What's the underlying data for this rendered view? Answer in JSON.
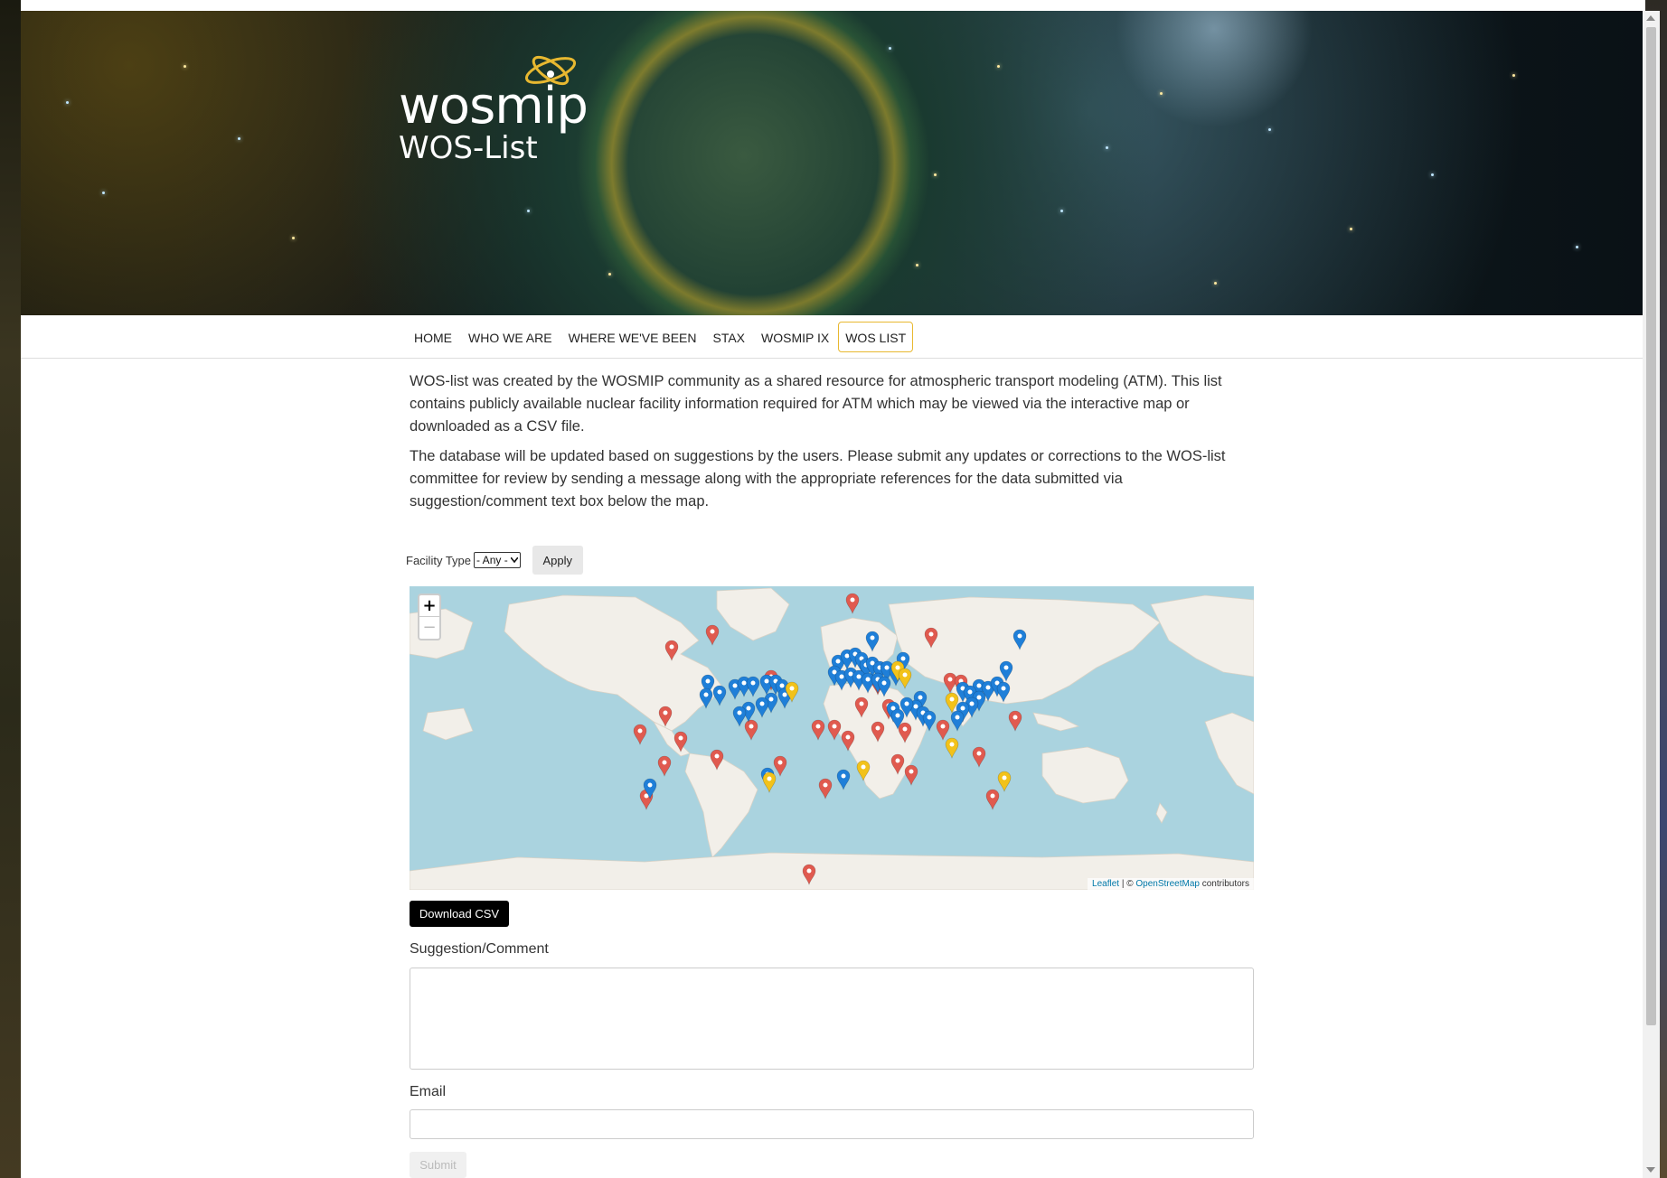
{
  "header": {
    "logo_text": "wosmip",
    "subtitle": "WOS-List"
  },
  "nav": {
    "items": [
      {
        "label": "HOME",
        "active": false
      },
      {
        "label": "WHO WE ARE",
        "active": false
      },
      {
        "label": "WHERE WE'VE BEEN",
        "active": false
      },
      {
        "label": "STAX",
        "active": false
      },
      {
        "label": "WOSMIP IX",
        "active": false
      },
      {
        "label": "WOS LIST",
        "active": true
      }
    ]
  },
  "intro": {
    "paragraph1": "WOS-list was created by the WOSMIP community as a shared resource for atmospheric transport modeling (ATM). This list contains publicly available nuclear facility information required for ATM which may be viewed via the interactive map or downloaded as a CSV file.",
    "paragraph2": "The database will be updated based on suggestions by the users. Please submit any updates or corrections to the WOS-list committee for review by sending a message along with the appropriate references for the data submitted via suggestion/comment text box below the map."
  },
  "filter": {
    "label": "Facility Type",
    "selected": "- Any -",
    "apply_label": "Apply"
  },
  "map": {
    "zoom_in": "+",
    "zoom_out": "−",
    "attribution_leaflet": "Leaflet",
    "attribution_sep": " | © ",
    "attribution_osm": "OpenStreetMap",
    "attribution_suffix": " contributors",
    "colors": {
      "water": "#aad3df",
      "land": "#f2efe9",
      "marker_red": "#e05a4f",
      "marker_blue": "#1f7fd8",
      "marker_yellow": "#f2c21a"
    }
  },
  "download_label": "Download CSV",
  "form": {
    "suggestion_label": "Suggestion/Comment",
    "suggestion_value": "",
    "email_label": "Email",
    "email_value": "",
    "submit_label": "Submit"
  },
  "colors": {
    "nav_active_border": "#e8b830",
    "download_bg": "#000000"
  }
}
